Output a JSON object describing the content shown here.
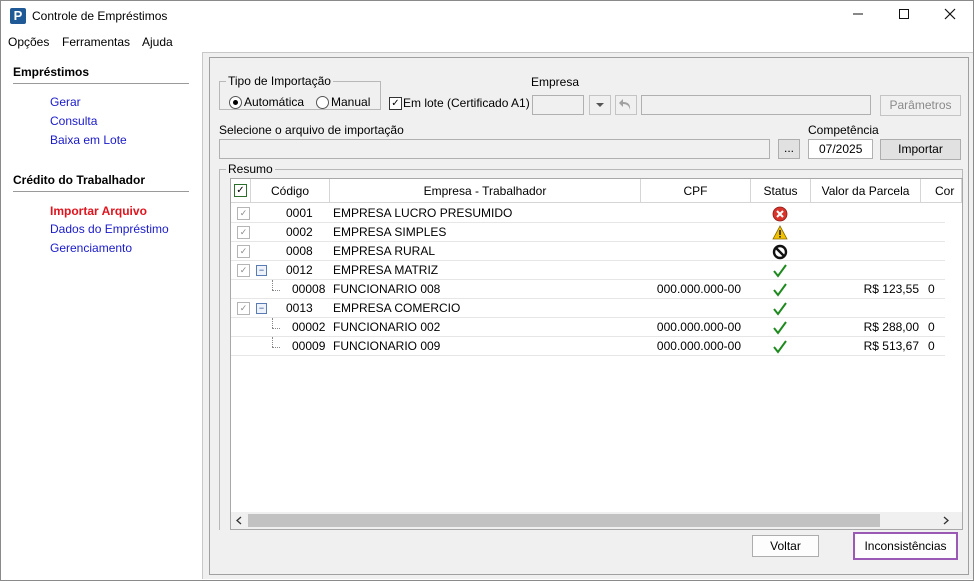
{
  "window": {
    "title": "Controle de Empréstimos",
    "minimize_icon": "minimize-icon",
    "maximize_icon": "maximize-icon",
    "close_icon": "close-icon"
  },
  "menu": [
    "Opções",
    "Ferramentas",
    "Ajuda"
  ],
  "sidebar": {
    "sections": [
      {
        "title": "Empréstimos",
        "items": [
          {
            "label": "Gerar",
            "active": false
          },
          {
            "label": "Consulta",
            "active": false
          },
          {
            "label": "Baixa em Lote",
            "active": false
          }
        ]
      },
      {
        "title": "Crédito do Trabalhador",
        "items": [
          {
            "label": "Importar Arquivo",
            "active": true
          },
          {
            "label": "Dados do Empréstimo",
            "active": false
          },
          {
            "label": "Gerenciamento",
            "active": false
          }
        ]
      }
    ]
  },
  "form": {
    "tipo_importacao_label": "Tipo de Importação",
    "radio_automatica": "Automática",
    "radio_manual": "Manual",
    "em_lote_label": "Em lote (Certificado A1)",
    "empresa_label": "Empresa",
    "parametros_button": "Parâmetros",
    "arquivo_label": "Selecione o arquivo de importação",
    "browse_button": "...",
    "competencia_label": "Competência",
    "competencia_value": "07/2025",
    "importar_button": "Importar",
    "resumo_label": "Resumo"
  },
  "grid": {
    "columns": [
      "Código",
      "Empresa - Trabalhador",
      "CPF",
      "Status",
      "Valor da Parcela",
      "Cor"
    ],
    "rows": [
      {
        "codigo": "0001",
        "nome": "EMPRESA LUCRO PRESUMIDO",
        "cpf": "",
        "status": "error",
        "valor": "",
        "cor": "",
        "level": 0,
        "expandable": false
      },
      {
        "codigo": "0002",
        "nome": "EMPRESA SIMPLES",
        "cpf": "",
        "status": "warning",
        "valor": "",
        "cor": "",
        "level": 0,
        "expandable": false
      },
      {
        "codigo": "0008",
        "nome": "EMPRESA RURAL",
        "cpf": "",
        "status": "blocked",
        "valor": "",
        "cor": "",
        "level": 0,
        "expandable": false
      },
      {
        "codigo": "0012",
        "nome": "EMPRESA MATRIZ",
        "cpf": "",
        "status": "ok",
        "valor": "",
        "cor": "",
        "level": 0,
        "expandable": true
      },
      {
        "codigo": "00008",
        "nome": "FUNCIONARIO 008",
        "cpf": "000.000.000-00",
        "status": "ok",
        "valor": "R$ 123,55",
        "cor": "0",
        "level": 1,
        "expandable": false
      },
      {
        "codigo": "0013",
        "nome": "EMPRESA COMERCIO",
        "cpf": "",
        "status": "ok",
        "valor": "",
        "cor": "",
        "level": 0,
        "expandable": true
      },
      {
        "codigo": "00002",
        "nome": "FUNCIONARIO 002",
        "cpf": "000.000.000-00",
        "status": "ok",
        "valor": "R$ 288,00",
        "cor": "0",
        "level": 1,
        "expandable": false
      },
      {
        "codigo": "00009",
        "nome": "FUNCIONARIO 009",
        "cpf": "000.000.000-00",
        "status": "ok",
        "valor": "R$ 513,67",
        "cor": "0",
        "level": 1,
        "expandable": false
      }
    ]
  },
  "footer": {
    "voltar_button": "Voltar",
    "inconsistencias_button": "Inconsistências"
  },
  "colors": {
    "accent_highlight": "#9b59b6",
    "link": "#1a1acc",
    "active_link": "#e0141e",
    "ok": "#1e8a1e",
    "error": "#d9342b",
    "warning": "#f2c200"
  }
}
